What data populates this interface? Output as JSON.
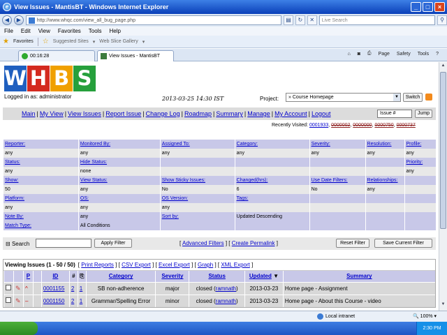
{
  "window": {
    "title": "View Issues - MantisBT - Windows Internet Explorer"
  },
  "browser": {
    "url": "http://www.whqc.com/view_all_bug_page.php",
    "search_placeholder": "Live Search",
    "menu": [
      "File",
      "Edit",
      "View",
      "Favorites",
      "Tools",
      "Help"
    ],
    "favorites": {
      "label": "Favorites",
      "items": [
        "Suggested Sites",
        "Web Slice Gallery"
      ]
    },
    "tabs": [
      {
        "label": "00:16:28"
      },
      {
        "label": "View Issues - MantisBT"
      }
    ],
    "tools": [
      "Page",
      "Safety",
      "Tools"
    ]
  },
  "page": {
    "logo_letters": [
      "W",
      "H",
      "B",
      "S"
    ],
    "logo_colors": [
      "#1f5fbf",
      "#d42a1f",
      "#f0a000",
      "#26a03c"
    ],
    "logged_in_label": "Logged in as:",
    "logged_in_user": "administrator",
    "datetime": "2013-03-25 14:30 IST",
    "project_label": "Project:",
    "project_value": "» Course Homepage",
    "switch_label": "Switch",
    "menu": [
      "Main",
      "My View",
      "View Issues",
      "Report Issue",
      "Change Log",
      "Roadmap",
      "Summary",
      "Manage",
      "My Account",
      "Logout"
    ],
    "issue_search_value": "Issue #",
    "jump_label": "Jump",
    "recently_visited_label": "Recently Visited:",
    "recently_visited": [
      "0001933",
      "0000002",
      "0000000",
      "0000750",
      "0000737"
    ]
  },
  "filters": {
    "row1_headers": [
      "Reporter:",
      "Monitored By:",
      "Assigned To:",
      "Category:",
      "Severity:",
      "Resolution:",
      "Profile:"
    ],
    "row1_values": [
      "any",
      "any",
      "any",
      "any",
      "any",
      "any",
      "any"
    ],
    "row2_headers": [
      "Status:",
      "Hide Status:",
      "",
      "",
      "",
      "",
      "Priority:"
    ],
    "row2_values": [
      "any",
      "none",
      "",
      "",
      "",
      "",
      "any"
    ],
    "row3_headers": [
      "Show:",
      "View Status:",
      "Show Sticky Issues:",
      "Changed(hrs):",
      "Use Date Filters:",
      "Relationships:",
      ""
    ],
    "row3_values": [
      "50",
      "any",
      "No",
      "6",
      "No",
      "any",
      ""
    ],
    "row4_headers": [
      "Platform:",
      "OS:",
      "OS Version:",
      "Tags:",
      "",
      "",
      ""
    ],
    "row4_values": [
      "any",
      "any",
      "any",
      "",
      "",
      "",
      ""
    ],
    "row5_headers": [
      "Note By:",
      "any",
      "Sort by:",
      "Updated Descending",
      "",
      "",
      ""
    ],
    "row6_headers": [
      "Match Type:",
      "All Conditions",
      "",
      "",
      "",
      "",
      ""
    ],
    "search_label": "Search",
    "apply_label": "Apply Filter",
    "advanced_label": "Advanced Filters",
    "permalink_label": "Create Permalink",
    "reset_label": "Reset Filter",
    "save_label": "Save Current Filter"
  },
  "issues": {
    "heading": "Viewing Issues (1 - 50 / 50)",
    "links": [
      "Print Reports",
      "CSV Export",
      "Excel Export",
      "Graph",
      "XML Export"
    ],
    "columns": [
      "P",
      "ID",
      "#",
      "",
      "Category",
      "Severity",
      "Status",
      "Updated",
      "Summary"
    ],
    "rows": [
      {
        "id": "0001155",
        "notes": "2",
        "attach": "1",
        "category": "SB non-adherence",
        "severity": "major",
        "status": "closed",
        "handler": "ramnath",
        "updated": "2013-03-23",
        "summary": "Home page - Assignment"
      },
      {
        "id": "0001150",
        "notes": "2",
        "attach": "1",
        "category": "Grammar/Spelling Error",
        "severity": "minor",
        "status": "closed",
        "handler": "ramnath",
        "updated": "2013-03-23",
        "summary": "Home page - About this Course - video"
      }
    ]
  },
  "status_bar": {
    "zone": "Local intranet",
    "zoom": "100%"
  },
  "taskbar": {
    "clock": "2:30 PM"
  }
}
